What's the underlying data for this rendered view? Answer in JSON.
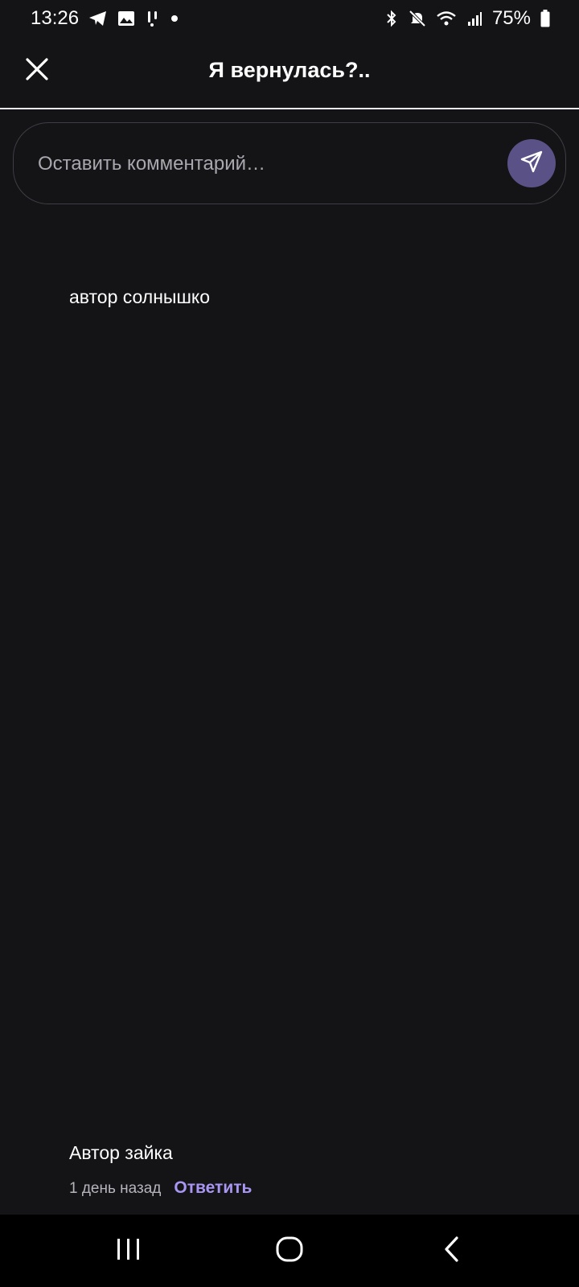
{
  "status_bar": {
    "time": "13:26",
    "battery": "75%",
    "left_icons": [
      "telegram-icon",
      "image-icon",
      "notification-icon",
      "dot-icon"
    ],
    "right_icons": [
      "bluetooth-icon",
      "mute-icon",
      "wifi-icon",
      "signal-icon",
      "battery-icon"
    ]
  },
  "header": {
    "title": "Я вернулась?..",
    "close_icon": "close-icon"
  },
  "comment_input": {
    "placeholder": "Оставить комментарий…",
    "value": "",
    "send_icon": "send-icon",
    "accent_color": "#5a5187"
  },
  "comments": [
    {
      "text": "автор солнышко"
    },
    {
      "text": "Автор зайка",
      "time": "1 день назад",
      "reply_label": "Ответить"
    }
  ],
  "nav_bar": {
    "buttons": [
      "recent-apps-icon",
      "home-icon",
      "back-icon"
    ]
  },
  "colors": {
    "background": "#141316",
    "link": "#a996f2"
  }
}
